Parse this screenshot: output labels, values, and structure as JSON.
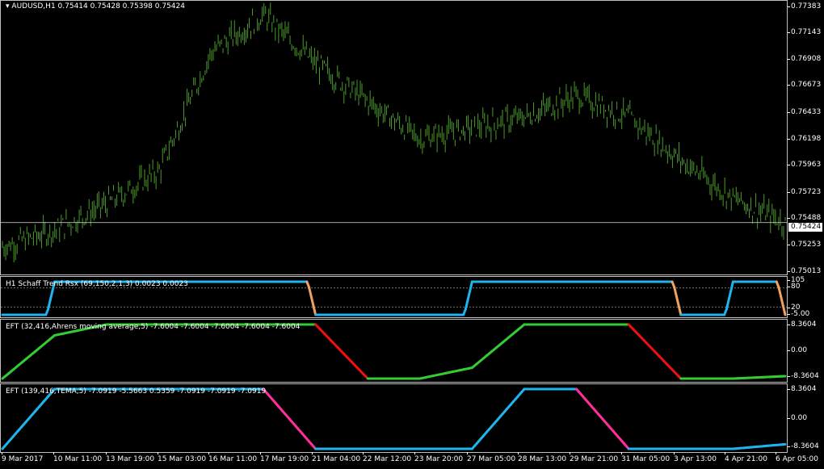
{
  "main": {
    "label": "AUDUSD,H1  0.75414 0.75428 0.75398 0.75424",
    "current_price": "0.75424",
    "price_ticks": [
      "0.77383",
      "0.77143",
      "0.76908",
      "0.76673",
      "0.76433",
      "0.76198",
      "0.75963",
      "0.75723",
      "0.75488",
      "0.75253",
      "0.75013"
    ]
  },
  "schaff": {
    "label": "H1 Schaff Trend Rsx (69,150,2,1,3) 0.0023 0.0023",
    "ticks": [
      "105",
      "80",
      "20",
      "-5.00"
    ]
  },
  "eft1": {
    "label": "EFT (32,416,Ahrens moving average,5)  -7.6004 -7.6004 -7.6004 -7.6004 -7.6004",
    "ticks": [
      "8.3604",
      "0.00",
      "-8.3604"
    ]
  },
  "eft2": {
    "label": "EFT (139,416,TEMA,5)  -7.0919 -5.5663 0.5359 -7.0919 -7.0919 -7.0919",
    "ticks": [
      "8.3604",
      "0.00",
      "-8.3604"
    ]
  },
  "time_axis": [
    "9 Mar 2017",
    "10 Mar 11:00",
    "13 Mar 19:00",
    "15 Mar 03:00",
    "16 Mar 11:00",
    "17 Mar 19:00",
    "21 Mar 04:00",
    "22 Mar 12:00",
    "23 Mar 20:00",
    "27 Mar 05:00",
    "28 Mar 13:00",
    "29 Mar 21:00",
    "31 Mar 05:00",
    "3 Apr 13:00",
    "4 Apr 21:00",
    "6 Apr 05:00"
  ],
  "colors": {
    "candles": "#4a9a2a",
    "schaff_up": "#1eb4ee",
    "schaff_down": "#f0a060",
    "eft_up": "#33cc33",
    "eft_down": "#ee1111",
    "eft2_up": "#1eb4ee",
    "eft2_down": "#ff2e9a",
    "grid": "#c0c0c0"
  },
  "chart_data": [
    {
      "type": "line",
      "name": "AUDUSD,H1",
      "note_series": "approximate hourly close",
      "x": [
        "9 Mar 2017",
        "10 Mar 11:00",
        "13 Mar 19:00",
        "15 Mar 03:00",
        "16 Mar 11:00",
        "17 Mar 19:00",
        "21 Mar 04:00",
        "22 Mar 12:00",
        "23 Mar 20:00",
        "27 Mar 05:00",
        "28 Mar 13:00",
        "29 Mar 21:00",
        "31 Mar 05:00",
        "3 Apr 13:00",
        "4 Apr 21:00",
        "6 Apr 05:00"
      ],
      "values": [
        0.752,
        0.7535,
        0.756,
        0.759,
        0.77,
        0.7735,
        0.769,
        0.7655,
        0.762,
        0.763,
        0.764,
        0.766,
        0.764,
        0.76,
        0.7565,
        0.7542
      ],
      "ylim": [
        0.7495,
        0.7745
      ]
    },
    {
      "type": "line",
      "name": "H1 Schaff Trend Rsx (69,150,2,1,3)",
      "values": [
        -5,
        100,
        100,
        100,
        100,
        100,
        -5,
        -5,
        -5,
        100,
        100,
        100,
        100,
        -5,
        100,
        -5
      ],
      "ylim": [
        -5,
        105
      ]
    },
    {
      "type": "line",
      "name": "EFT (32,416,Ahrens moving average,5)",
      "values": [
        -8.36,
        5,
        8.36,
        8.36,
        8.36,
        8.36,
        8.36,
        -8.36,
        -8.36,
        -5,
        8.36,
        8.36,
        8.36,
        -8.36,
        -8.36,
        -7.6
      ],
      "ylim": [
        -8.3604,
        8.3604
      ]
    },
    {
      "type": "line",
      "name": "EFT (139,416,TEMA,5)",
      "values": [
        -8.36,
        8.36,
        8.36,
        8.36,
        8.36,
        8.36,
        -8.36,
        -8.36,
        -8.36,
        -8.36,
        8.36,
        8.36,
        -8.36,
        -8.36,
        -8.36,
        -7.09
      ],
      "ylim": [
        -8.3604,
        8.3604
      ]
    }
  ]
}
